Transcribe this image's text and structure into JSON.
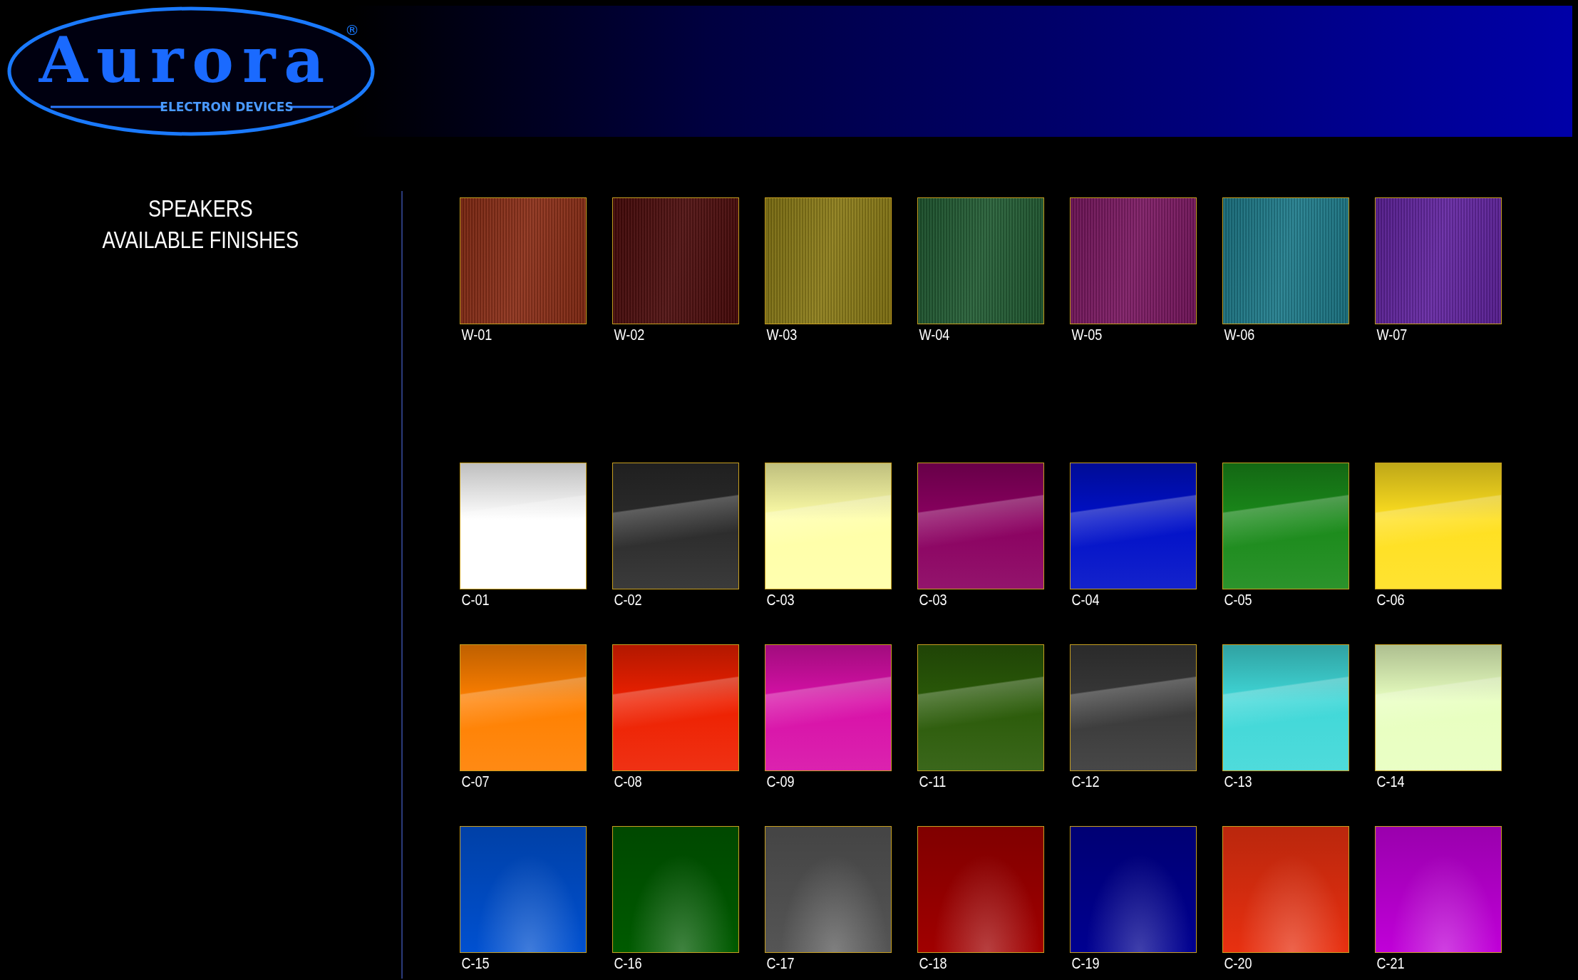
{
  "logo": {
    "name": "Aurora",
    "tagline": "ELECTRON DEVICES",
    "registered": "®"
  },
  "heading": [
    "SPEAKERS",
    "AVAILABLE FINISHES"
  ],
  "sections": [
    {
      "swatches": [
        {
          "code": "W-01",
          "kind": "wood",
          "color": "#8a2a12"
        },
        {
          "code": "W-02",
          "kind": "wood",
          "color": "#4a0808"
        },
        {
          "code": "W-03",
          "kind": "wood",
          "color": "#8a7a12"
        },
        {
          "code": "W-04",
          "kind": "wood",
          "color": "#1e5a30"
        },
        {
          "code": "W-05",
          "kind": "wood",
          "color": "#7a1460"
        },
        {
          "code": "W-06",
          "kind": "wood",
          "color": "#1a7a8a"
        },
        {
          "code": "W-07",
          "kind": "wood",
          "color": "#6020a0"
        }
      ]
    },
    {
      "swatches": [
        {
          "code": "C-01",
          "kind": "gloss",
          "color": "#ffffff"
        },
        {
          "code": "C-02",
          "kind": "gloss",
          "color": "#2a2a2a"
        },
        {
          "code": "C-03",
          "kind": "gloss",
          "color": "#ffffa8"
        },
        {
          "code": "C-03",
          "kind": "gloss",
          "color": "#8a0060"
        },
        {
          "code": "C-04",
          "kind": "gloss",
          "color": "#0010c8"
        },
        {
          "code": "C-05",
          "kind": "gloss",
          "color": "#1a8a1a"
        },
        {
          "code": "C-06",
          "kind": "gloss",
          "color": "#ffe020"
        },
        {
          "code": "C-07",
          "kind": "gloss",
          "color": "#ff8000"
        },
        {
          "code": "C-08",
          "kind": "gloss",
          "color": "#ee2000"
        },
        {
          "code": "C-09",
          "kind": "gloss",
          "color": "#d810a8"
        },
        {
          "code": "C-11",
          "kind": "gloss",
          "color": "#2a5a08"
        },
        {
          "code": "C-12",
          "kind": "gloss",
          "color": "#383838"
        },
        {
          "code": "C-13",
          "kind": "gloss",
          "color": "#40d8d8"
        },
        {
          "code": "C-14",
          "kind": "gloss",
          "color": "#e8ffc0"
        },
        {
          "code": "C-15",
          "kind": "radial",
          "color": "#0050d0"
        },
        {
          "code": "C-16",
          "kind": "radial",
          "color": "#005a00"
        },
        {
          "code": "C-17",
          "kind": "radial",
          "color": "#555555"
        },
        {
          "code": "C-18",
          "kind": "radial",
          "color": "#a00000"
        },
        {
          "code": "C-19",
          "kind": "radial",
          "color": "#000090"
        },
        {
          "code": "C-20",
          "kind": "radial",
          "color": "#e83010"
        },
        {
          "code": "C-21",
          "kind": "radial",
          "color": "#c000d8"
        }
      ]
    }
  ]
}
